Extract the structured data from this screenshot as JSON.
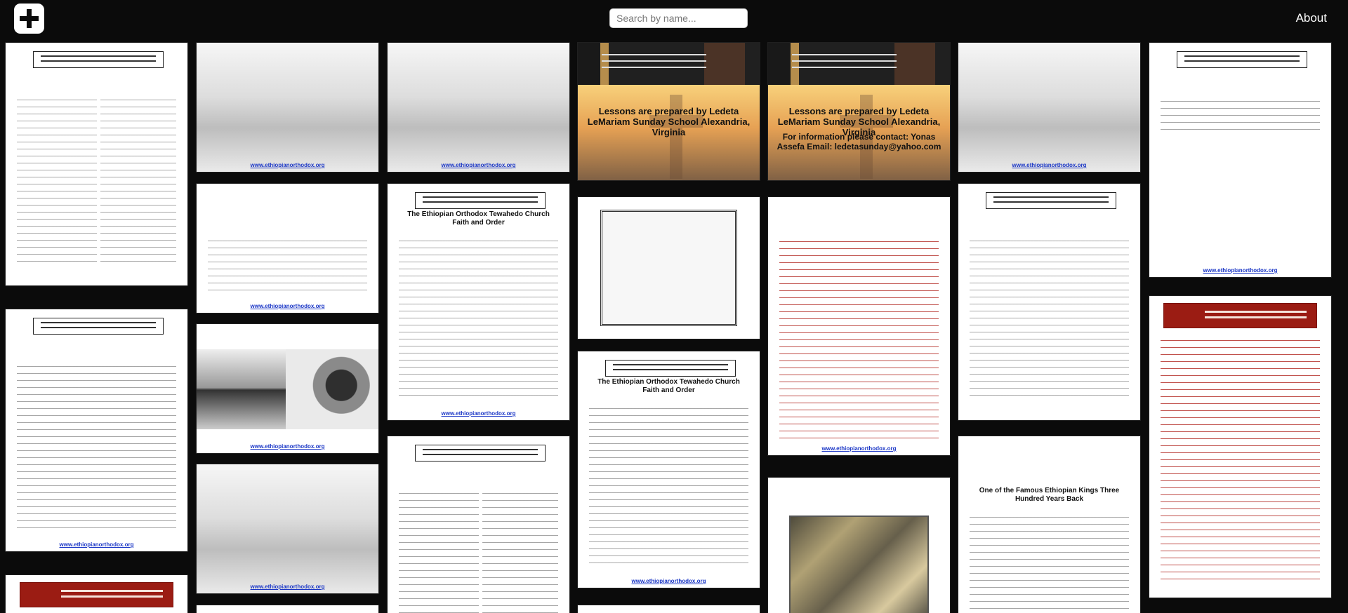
{
  "search": {
    "placeholder": "Search by name..."
  },
  "nav": {
    "about": "About"
  },
  "icons": {
    "logo": "plus-square-icon"
  },
  "colors": {
    "background": "#0b0b0b",
    "link": "#1a36c6",
    "accent_red": "#9b1c13"
  },
  "cards": {
    "orthodox_link": "www.ethiopianorthodox.org",
    "faith_header": "The Ethiopian Orthodox Tewahedo Church Faith and Order",
    "lesson_title": "Lessons are prepared by Ledeta LeMariam Sunday School Alexandria, Virginia",
    "lesson_contact": "For information please contact: Yonas Assefa Email: ledetasunday@yahoo.com",
    "chronicle_title": "One of the Famous Ethiopian Kings Three Hundred Years Back"
  }
}
